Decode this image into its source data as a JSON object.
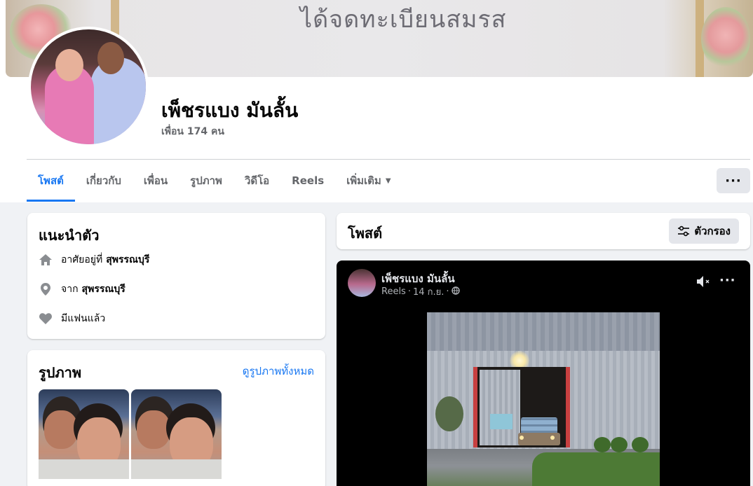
{
  "profile": {
    "cover_text": "ได้จดทะเบียนสมรส",
    "name": "เพ็ชรแบง มันลั้น",
    "friends": "เพื่อน 174 คน"
  },
  "tabs": [
    {
      "label": "โพสต์",
      "active": true
    },
    {
      "label": "เกี่ยวกับ"
    },
    {
      "label": "เพื่อน"
    },
    {
      "label": "รูปภาพ"
    },
    {
      "label": "วิดีโอ"
    },
    {
      "label": "Reels"
    },
    {
      "label": "เพิ่มเติม"
    }
  ],
  "more_button": "···",
  "intro": {
    "title": "แนะนำตัว",
    "lives_in_prefix": "อาศัยอยู่ที่",
    "lives_in": "สุพรรณบุรี",
    "from_prefix": "จาก",
    "from": "สุพรรณบุรี",
    "relationship": "มีแฟนแล้ว",
    "icons": [
      "home-icon",
      "location-pin-icon",
      "heart-icon"
    ]
  },
  "photos": {
    "title": "รูปภาพ",
    "see_all": "ดูรูปภาพทั้งหมด"
  },
  "posts": {
    "title": "โพสต์",
    "filter_label": "ตัวกรอง",
    "post": {
      "author": "เพ็ชรแบง มันลั้น",
      "source": "Reels",
      "date": "14 ก.ย.",
      "separator": "·",
      "privacy_icon": "globe-icon",
      "more": "···"
    }
  },
  "colors": {
    "accent": "#1877f2",
    "page_bg": "#f0f2f5",
    "secondary_text": "#65676b",
    "button_bg": "#e4e6eb"
  }
}
